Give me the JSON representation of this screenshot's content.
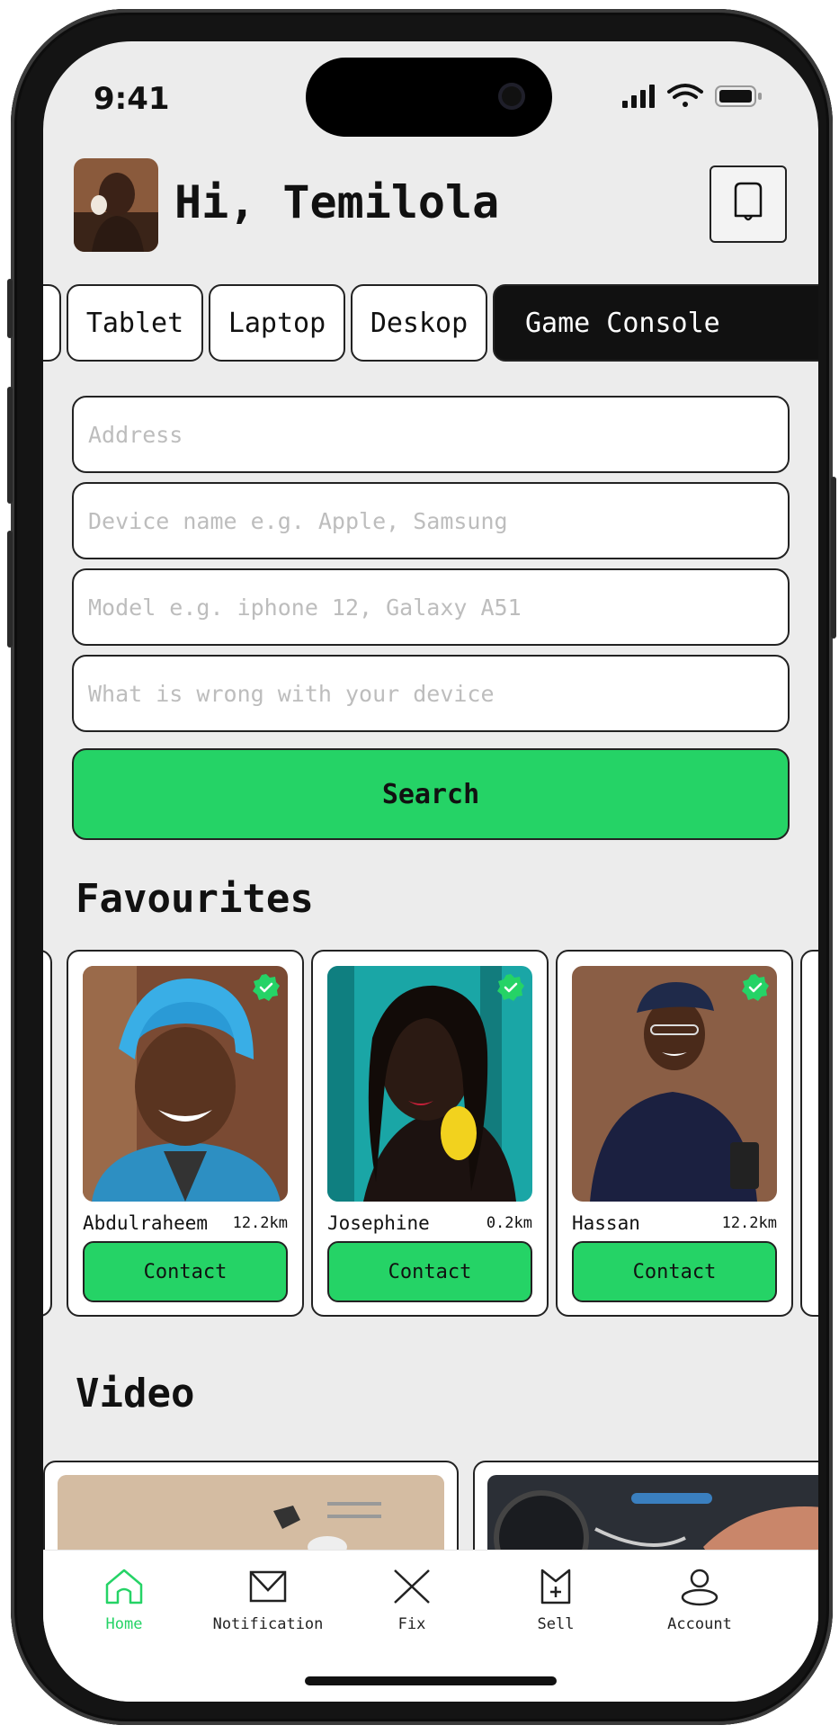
{
  "status_bar": {
    "time": "9:41"
  },
  "header": {
    "greeting": "Hi, Temilola"
  },
  "categories": {
    "items": [
      "Tablet",
      "Laptop",
      "Deskop",
      "Game Console"
    ],
    "active": "Game Console"
  },
  "form": {
    "address_placeholder": "Address",
    "device_placeholder": "Device name e.g. Apple, Samsung",
    "model_placeholder": "Model e.g. iphone 12, Galaxy A51",
    "issue_placeholder": "What is wrong with your device",
    "search_label": "Search"
  },
  "favourites": {
    "title": "Favourites",
    "items": [
      {
        "name": "Abdulraheem",
        "distance": "12.2km",
        "contact_label": "Contact",
        "verified": true
      },
      {
        "name": "Josephine",
        "distance": "0.2km",
        "contact_label": "Contact",
        "verified": true
      },
      {
        "name": "Hassan",
        "distance": "12.2km",
        "contact_label": "Contact",
        "verified": true
      }
    ]
  },
  "video": {
    "title": "Video"
  },
  "tabbar": {
    "items": [
      {
        "label": "Home",
        "icon": "home-icon",
        "active": true
      },
      {
        "label": "Notification",
        "icon": "mail-icon",
        "active": false
      },
      {
        "label": "Fix",
        "icon": "fix-icon",
        "active": false
      },
      {
        "label": "Sell",
        "icon": "sell-icon",
        "active": false
      },
      {
        "label": "Account",
        "icon": "account-icon",
        "active": false
      }
    ]
  },
  "colors": {
    "accent": "#25d366",
    "background": "#ececec",
    "dark": "#111111"
  }
}
